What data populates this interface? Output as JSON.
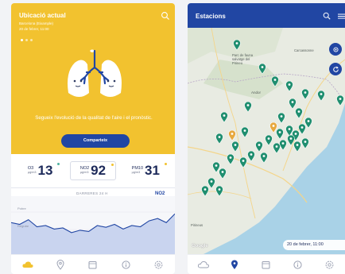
{
  "left": {
    "location_title": "Ubicació actual",
    "location_sub": "Barcelona (Eixample)",
    "location_date": "20 de febrer, 11:00",
    "hero_message": "Segueix l'evolució de la qualitat de l'aire i el pronòstic.",
    "share_label": "Comparteix",
    "readings": [
      {
        "pollutant": "O3",
        "unit": "µg/m3",
        "value": "13"
      },
      {
        "pollutant": "NO2",
        "unit": "µg/m3",
        "value": "92"
      },
      {
        "pollutant": "PM10",
        "unit": "µg/m3",
        "value": "31"
      }
    ],
    "chart_label": "DARRERES 24 H",
    "chart_pollutant": "NO2",
    "level_labels": [
      "Pobre",
      "Regular"
    ],
    "tabs": [
      "cloud-icon",
      "location-pin-icon",
      "calendar-icon",
      "info-icon",
      "settings-icon"
    ],
    "chart_data": {
      "type": "area",
      "series": [
        {
          "values": [
            0.55,
            0.52,
            0.6,
            0.48,
            0.5,
            0.44,
            0.46,
            0.38,
            0.42,
            0.4,
            0.5,
            0.47,
            0.52,
            0.44,
            0.5,
            0.48,
            0.58,
            0.62,
            0.55,
            0.7
          ]
        }
      ]
    }
  },
  "right": {
    "title": "Estacions",
    "date_label": "20 de febrer, 11:00",
    "google": "Google",
    "map_labels": [
      {
        "text": "Parc de fauna salvatge del Pirineu",
        "key": "parc"
      },
      {
        "text": "Carcassonne",
        "key": "carcassonne"
      },
      {
        "text": "Pirineus",
        "key": "pirineus"
      }
    ],
    "tabs": [
      "cloud-icon",
      "location-pin-icon",
      "calendar-icon",
      "info-icon",
      "settings-icon"
    ],
    "active_tab": 1
  },
  "colors": {
    "yellow": "#f2c22f",
    "blue": "#2146a3",
    "marker_teal": "#1f8e6f",
    "marker_orange": "#e7a83e"
  }
}
